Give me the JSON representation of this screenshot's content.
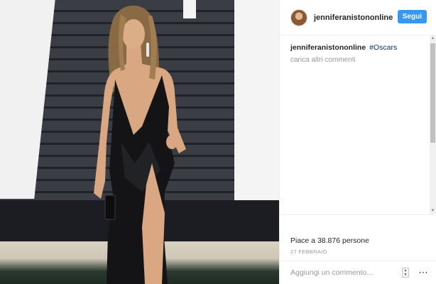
{
  "header": {
    "username": "jenniferanistononline",
    "follow_label": "Segui"
  },
  "caption": {
    "username": "jenniferanistononline",
    "hashtag": "#Oscars"
  },
  "comments": {
    "load_more_label": "carica altri commenti"
  },
  "likes": {
    "prefix": "Piace a ",
    "count": "38.876",
    "suffix": " persone"
  },
  "post_date": "27 FEBBRAIO",
  "comment_box": {
    "placeholder": "Aggiungi un commento..."
  },
  "icons": {
    "avatar": "profile-avatar",
    "more": "more-options-icon",
    "spinner": "spinner-control"
  },
  "colors": {
    "follow_button": "#3897f0",
    "hashtag": "#003569",
    "muted_text": "#999999"
  }
}
